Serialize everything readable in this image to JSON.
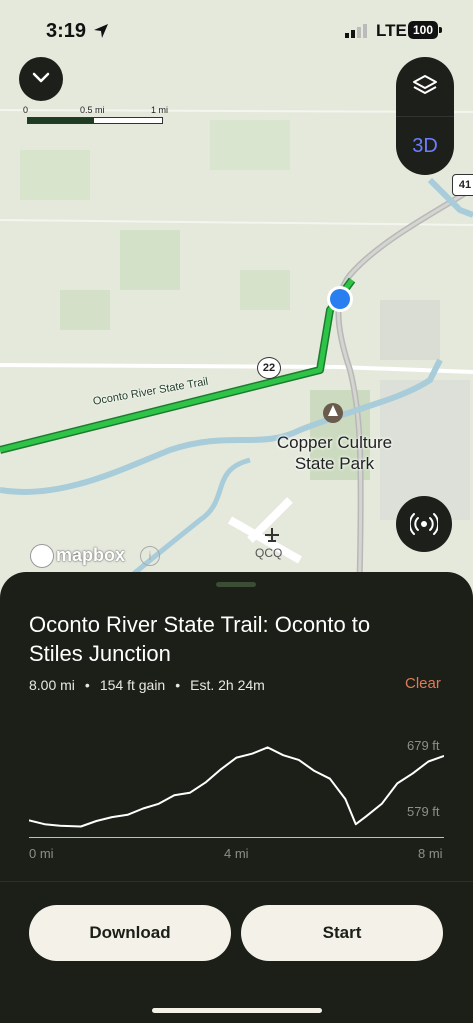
{
  "status_bar": {
    "time": "3:19",
    "network": "LTE",
    "battery": "100"
  },
  "map": {
    "scale": {
      "zero": "0",
      "half": "0.5 mi",
      "one": "1 mi"
    },
    "layers_button": "layers-icon",
    "three_d_label": "3D",
    "park_name": "Copper Culture State Park",
    "airport_code": "QCQ",
    "route_22": "22",
    "route_41": "41",
    "trail_label": "Oconto River State Trail",
    "attribution": "mapbox",
    "colors": {
      "map_bg": "#e4e9dc",
      "trail": "#2ec448",
      "water": "#a8ccd9",
      "location_dot": "#2a7ff0"
    }
  },
  "trail": {
    "title": "Oconto River State Trail: Oconto to Stiles Junction",
    "distance": "8.00 mi",
    "gain": "154 ft gain",
    "estimate": "Est. 2h 24m",
    "clear_label": "Clear"
  },
  "chart_data": {
    "type": "line",
    "title": "",
    "xlabel": "",
    "ylabel": "",
    "y_tick_labels": [
      "679 ft",
      "579 ft"
    ],
    "x_tick_labels": [
      "0 mi",
      "4 mi",
      "8 mi"
    ],
    "xlim": [
      0,
      8
    ],
    "ylim": [
      570,
      690
    ],
    "x": [
      0,
      0.3,
      0.6,
      1.0,
      1.3,
      1.6,
      1.9,
      2.2,
      2.5,
      2.8,
      3.1,
      3.4,
      3.7,
      4.0,
      4.3,
      4.6,
      4.9,
      5.2,
      5.5,
      5.8,
      6.1,
      6.3,
      6.5,
      6.8,
      7.1,
      7.4,
      7.7,
      8.0
    ],
    "values": [
      585,
      580,
      578,
      577,
      584,
      589,
      592,
      600,
      606,
      617,
      620,
      633,
      650,
      665,
      670,
      678,
      668,
      662,
      648,
      638,
      612,
      580,
      590,
      606,
      632,
      645,
      660,
      667
    ]
  },
  "actions": {
    "download": "Download",
    "start": "Start"
  }
}
